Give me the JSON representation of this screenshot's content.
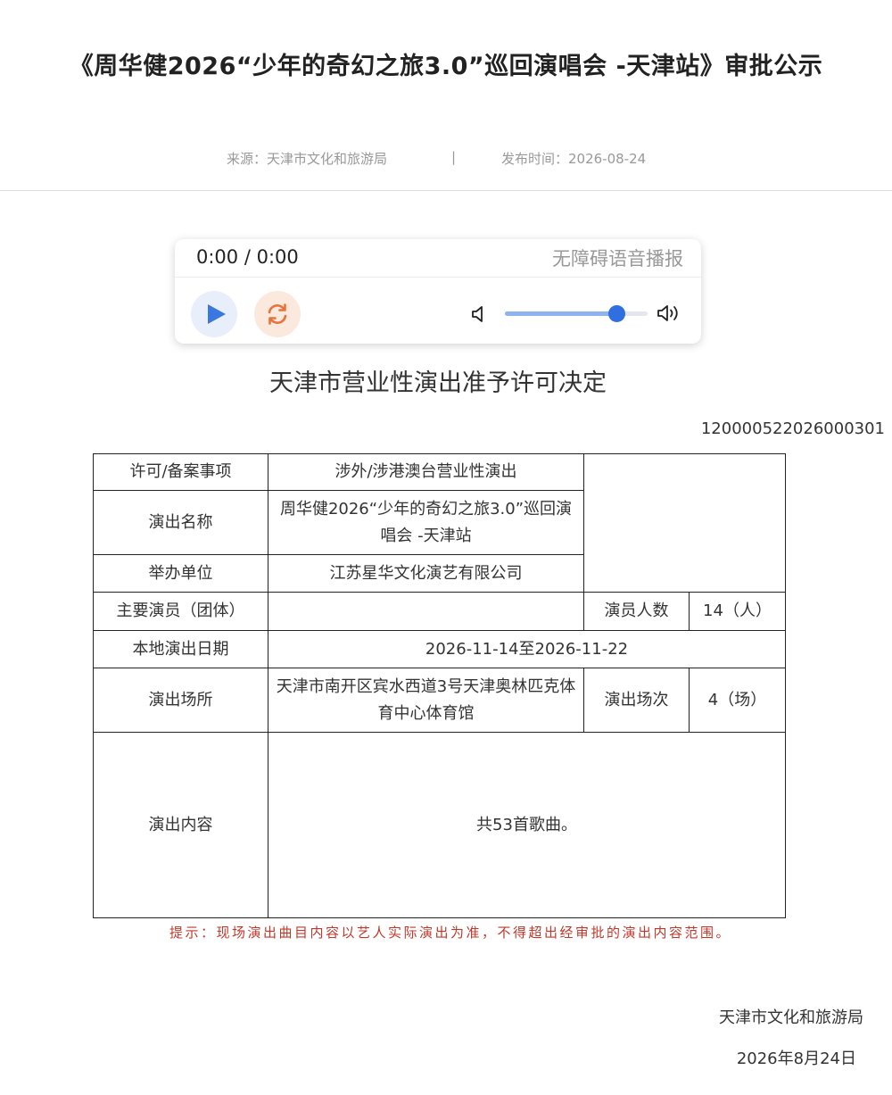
{
  "page": {
    "title": "《周华健2026“少年的奇幻之旅3.0”巡回演唱会 -天津站》审批公示",
    "source": "来源：天津市文化和旅游局",
    "separator": "|",
    "publish_date": "发布时间：2026-08-24"
  },
  "player": {
    "time": "0:00 / 0:00",
    "accessibility_label": "无障碍语音播报",
    "volume": 0.78,
    "colors": {
      "accent": "#2f6fe0",
      "loop": "#e8743b"
    },
    "icons": [
      "play-icon",
      "loop-icon",
      "volume-low-icon",
      "volume-high-icon"
    ]
  },
  "document": {
    "heading": "天津市营业性演出准予许可决定",
    "number": "120000522026000301",
    "rows": [
      {
        "label": "许可/备案事项",
        "value": "涉外/涉港澳台营业性演出"
      },
      {
        "label": "演出名称",
        "value": "周华健2026“少年的奇幻之旅3.0”巡回演唱会 -天津站"
      },
      {
        "label": "举办单位",
        "value": "江苏星华文化演艺有限公司"
      },
      {
        "label": "主要演员（团体）",
        "value": "",
        "extra_label": "演员人数",
        "extra_value": "14（人）"
      },
      {
        "label": "本地演出日期",
        "value": "2026-11-14至2026-11-22"
      },
      {
        "label": "演出场所",
        "value": "天津市南开区宾水西道3号天津奥林匹克体育中心体育馆",
        "extra_label": "演出场次",
        "extra_value": "4（场）"
      },
      {
        "label": "演出内容",
        "value": "共53首歌曲。"
      }
    ],
    "notice": "提示：现场演出曲目内容以艺人实际演出为准，不得超出经审批的演出内容范围。",
    "notice_color": "#c0392b",
    "issuer": "天津市文化和旅游局",
    "issue_date": "2026年8月24日"
  }
}
